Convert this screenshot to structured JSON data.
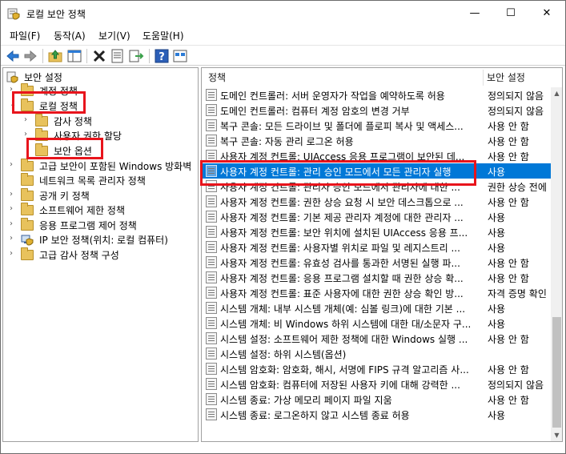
{
  "window": {
    "title": "로컬 보안 정책",
    "minimize": "—",
    "maximize": "☐",
    "close": "✕"
  },
  "menu": [
    "파일(F)",
    "동작(A)",
    "보기(V)",
    "도움말(H)"
  ],
  "toolbar": [
    "back-arrow-icon",
    "forward-arrow-icon",
    "up-folder-icon",
    "show-hide-tree-icon",
    "delete-icon",
    "properties-icon",
    "export-list-icon",
    "help-icon",
    "console-view-icon"
  ],
  "tree": {
    "root": "보안 설정",
    "items": [
      {
        "label": "계정 정책"
      },
      {
        "label": "로컬 정책"
      },
      {
        "label": "감사 정책"
      },
      {
        "label": "사용자 권한 할당"
      },
      {
        "label": "보안 옵션"
      },
      {
        "label": "고급 보안이 포함된 Windows 방화벽"
      },
      {
        "label": "네트워크 목록 관리자 정책"
      },
      {
        "label": "공개 키 정책"
      },
      {
        "label": "소프트웨어 제한 정책"
      },
      {
        "label": "응용 프로그램 제어 정책"
      },
      {
        "label": "IP 보안 정책(위치: 로컬 컴퓨터)"
      },
      {
        "label": "고급 감사 정책 구성"
      }
    ]
  },
  "list": {
    "col_policy": "정책",
    "col_setting": "보안 설정",
    "rows": [
      {
        "name": "도메인 컨트롤러: 서버 운영자가 작업을 예약하도록 허용",
        "setting": "정의되지 않음"
      },
      {
        "name": "도메인 컨트롤러: 컴퓨터 계정 암호의 변경 거부",
        "setting": "정의되지 않음"
      },
      {
        "name": "복구 콘솔: 모든 드라이브 및 폴더에 플로피 복사 및 액세스...",
        "setting": "사용 안 함"
      },
      {
        "name": "복구 콘솔: 자동 관리 로그온 허용",
        "setting": "사용 안 함"
      },
      {
        "name": "사용자 계정 컨트롤: UIAccess 응용 프로그램이 보안된 데...",
        "setting": "사용 안 함"
      },
      {
        "name": "사용자 계정 컨트롤: 관리 승인 모드에서 모든 관리자 실행",
        "setting": "사용",
        "selected": true
      },
      {
        "name": "사용자 계정 컨트롤: 관리자 승인 모드에서 관리자에 대한 ...",
        "setting": "권한 상승 전에"
      },
      {
        "name": "사용자 계정 컨트롤: 권한 상승 요청 시 보안 데스크톱으로 ...",
        "setting": "사용 안 함"
      },
      {
        "name": "사용자 계정 컨트롤: 기본 제공 관리자 계정에 대한 관리자 ...",
        "setting": "사용"
      },
      {
        "name": "사용자 계정 컨트롤: 보안 위치에 설치된 UIAccess 응용 프...",
        "setting": "사용"
      },
      {
        "name": "사용자 계정 컨트롤: 사용자별 위치로 파일 및 레지스트리 ...",
        "setting": "사용"
      },
      {
        "name": "사용자 계정 컨트롤: 유효성 검사를 통과한 서명된 실행 파...",
        "setting": "사용 안 함"
      },
      {
        "name": "사용자 계정 컨트롤: 응용 프로그램 설치할 때 권한 상승 확...",
        "setting": "사용 안 함"
      },
      {
        "name": "사용자 계정 컨트롤: 표준 사용자에 대한 권한 상승 확인 방...",
        "setting": "자격 증명 확인"
      },
      {
        "name": "시스템 개체: 내부 시스템 개체(예: 심볼 링크)에 대한 기본 ...",
        "setting": "사용"
      },
      {
        "name": "시스템 개체: 비 Windows 하위 시스템에 대한 대/소문자 구...",
        "setting": "사용"
      },
      {
        "name": "시스템 설정: 소프트웨어 제한 정책에 대한 Windows 실행 ...",
        "setting": "사용 안 함"
      },
      {
        "name": "시스템 설정: 하위 시스템(옵션)",
        "setting": ""
      },
      {
        "name": "시스템 암호화: 암호화, 해시, 서명에 FIPS 규격 알고리즘 사...",
        "setting": "사용 안 함"
      },
      {
        "name": "시스템 암호화: 컴퓨터에 저장된 사용자 키에 대해 강력한 ...",
        "setting": "정의되지 않음"
      },
      {
        "name": "시스템 종료: 가상 메모리 페이지 파일 지움",
        "setting": "사용 안 함"
      },
      {
        "name": "시스템 종료: 로그온하지 않고 시스템 종료 허용",
        "setting": "사용"
      }
    ]
  },
  "colors": {
    "selection": "#0078d7",
    "annotation": "#e8141c",
    "folder": "#e8c25c"
  }
}
